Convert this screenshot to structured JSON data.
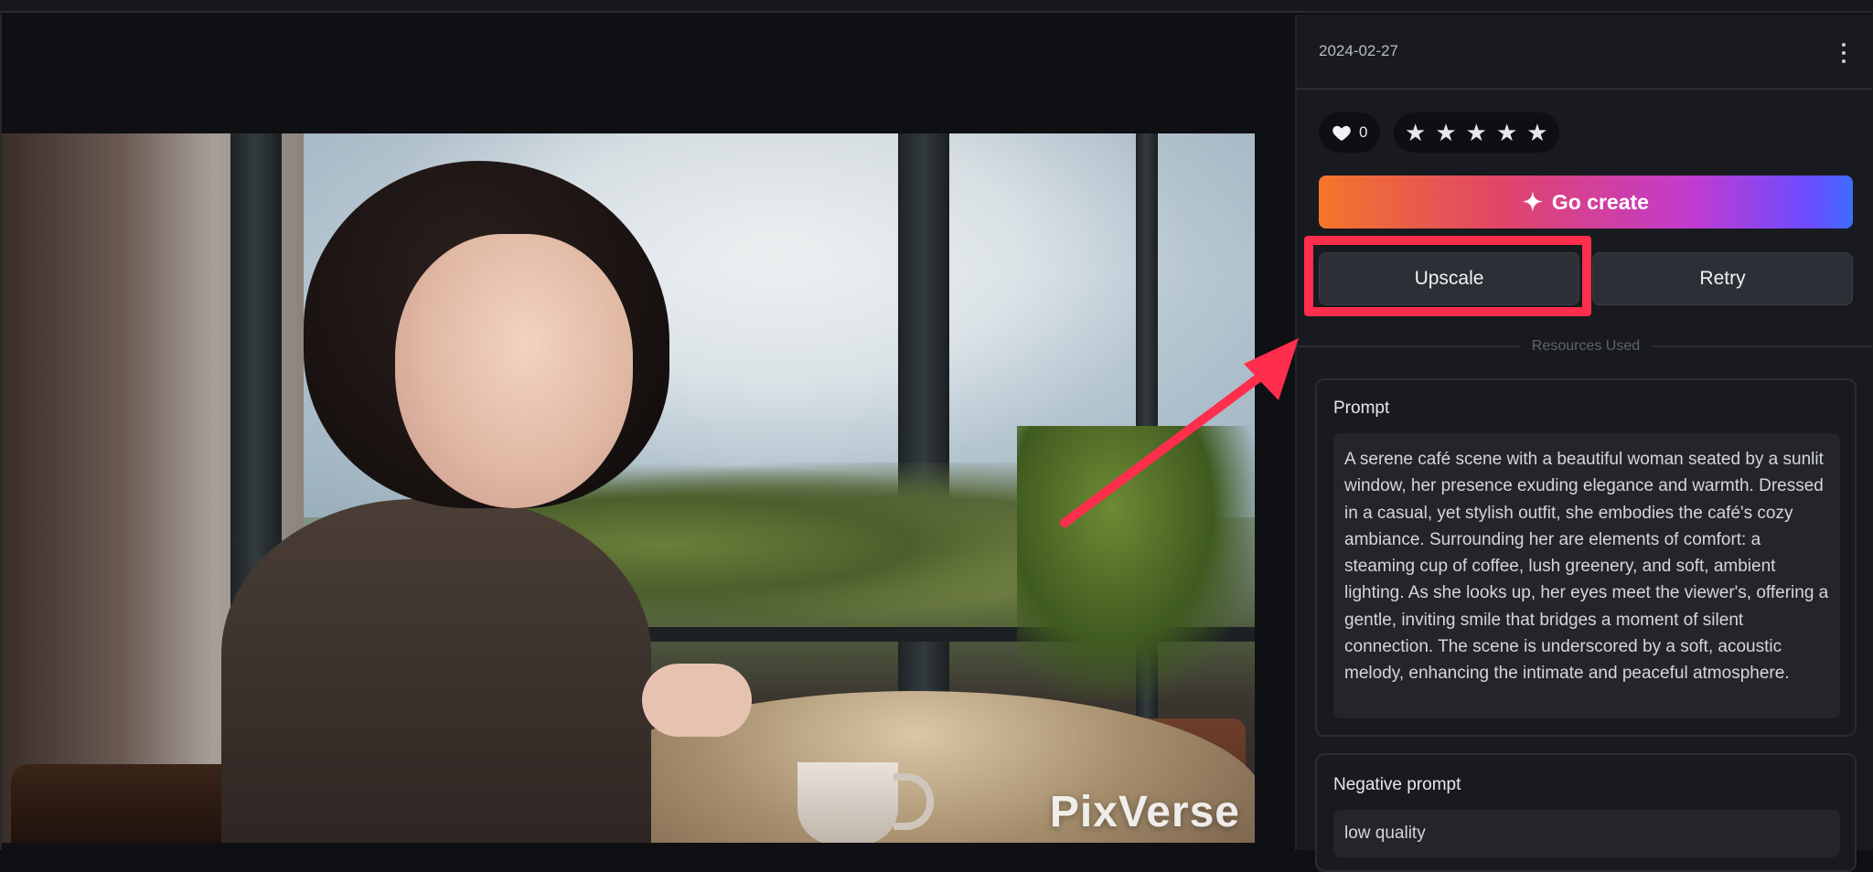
{
  "image": {
    "watermark": "PixVerse"
  },
  "panel": {
    "date": "2024-02-27",
    "likes_count": "0",
    "rating_stars": [
      "★",
      "★",
      "★",
      "★",
      "★"
    ],
    "go_create_label": "Go create",
    "upscale_label": "Upscale",
    "retry_label": "Retry",
    "resources_label": "Resources Used",
    "prompt_title": "Prompt",
    "prompt_text": "A serene café scene with a beautiful woman seated by a sunlit window, her presence exuding elegance and warmth. Dressed in a casual, yet stylish outfit, she embodies the café's cozy ambiance. Surrounding her are elements of comfort: a steaming cup of coffee, lush greenery, and soft, ambient lighting. As she looks up, her eyes meet the viewer's, offering a gentle, inviting smile that bridges a moment of silent connection. The scene is underscored by a soft, acoustic melody, enhancing the intimate and peaceful atmosphere.",
    "negative_prompt_title": "Negative prompt",
    "negative_prompt_text": "low quality"
  },
  "colors": {
    "accent_highlight": "#ff2e4c"
  }
}
